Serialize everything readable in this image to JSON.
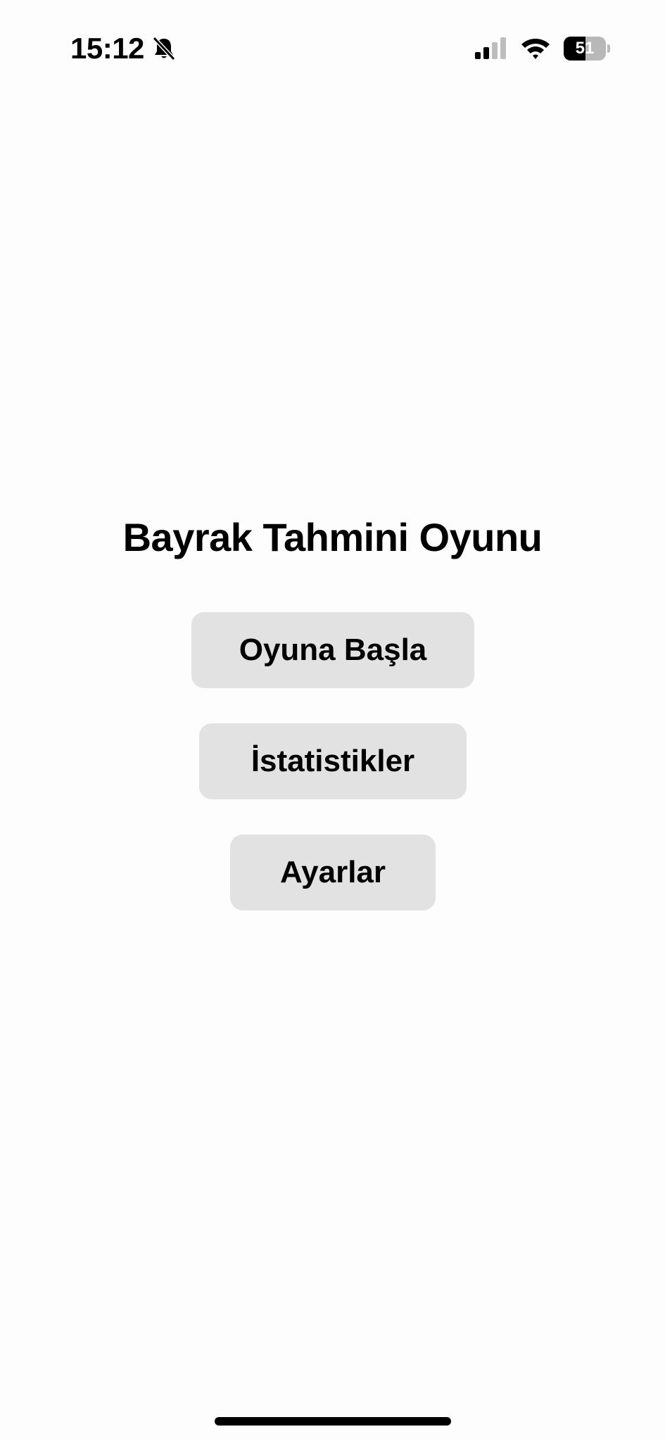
{
  "status_bar": {
    "time": "15:12",
    "silent_icon": "bell-slash-icon",
    "signal_icon": "cellular-signal-icon",
    "signal_strength": 0.5,
    "wifi_icon": "wifi-icon",
    "battery_level": "51",
    "battery_fraction": 0.51
  },
  "main": {
    "title": "Bayrak Tahmini Oyunu",
    "buttons": {
      "start_label": "Oyuna Başla",
      "stats_label": "İstatistikler",
      "settings_label": "Ayarlar"
    }
  },
  "colors": {
    "background": "#fdfdfd",
    "button_background": "#e2e2e2",
    "text": "#000000"
  }
}
